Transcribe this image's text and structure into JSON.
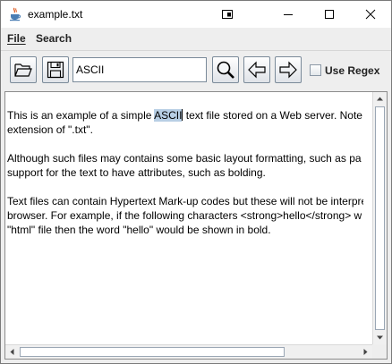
{
  "window": {
    "title": "example.txt",
    "icons": [
      "java-cup-icon",
      "snap-layout-icon",
      "minimize-icon",
      "maximize-icon",
      "close-icon"
    ]
  },
  "menu": {
    "file_label": "File",
    "search_label": "Search"
  },
  "toolbar": {
    "search_value": "ASCII",
    "use_regex_label": "Use Regex",
    "use_regex_checked": false,
    "icons": [
      "open-folder-icon",
      "save-disk-icon",
      "magnifier-icon",
      "arrow-left-icon",
      "arrow-right-icon"
    ]
  },
  "editor": {
    "p1_before": "This is an example of a simple ",
    "p1_highlight": "ASCII",
    "p1_after": " text file stored on a Web server. Note t",
    "p1_line2": "extension of \".txt\".",
    "p2_line1": "Although such files may contains some basic layout formatting, such as pa",
    "p2_line2": "support for the text to have attributes, such as bolding.",
    "p3_line1": "Text files can contain Hypertext Mark-up codes but these will not be interpre",
    "p3_line2": "browser. For example, if the following characters <strong>hello</strong> w",
    "p3_line3": "\"html\" file then the word \"hello\" would be shown in bold."
  },
  "colors": {
    "selection": "#b8cfe5",
    "window_bg": "#eeeeee",
    "editor_bg": "#ffffff"
  }
}
